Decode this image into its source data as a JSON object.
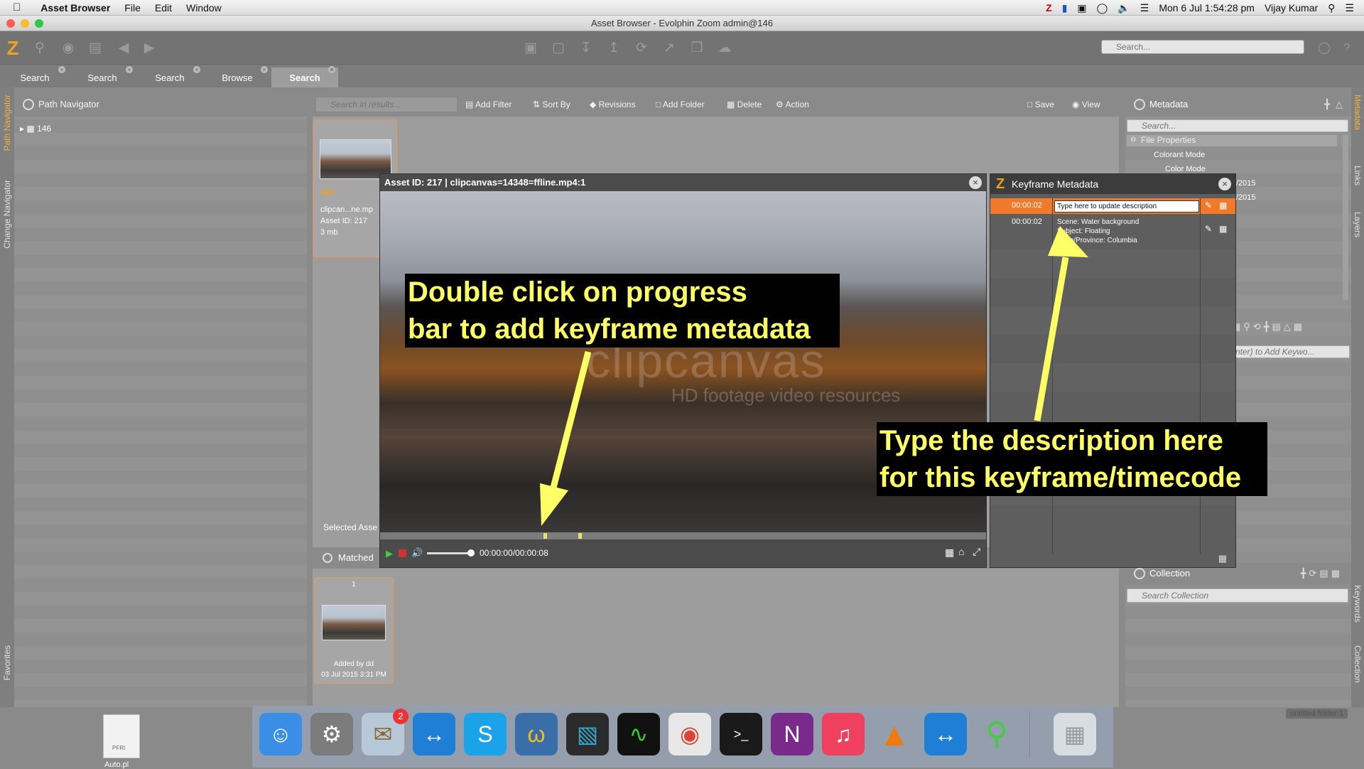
{
  "menubar": {
    "apple": "",
    "app_name": "Asset Browser",
    "menus": [
      "File",
      "Edit",
      "Window"
    ],
    "datetime": "Mon 6 Jul  1:54:28 pm",
    "user": "Vijay Kumar"
  },
  "window": {
    "title": "Asset Browser - Evolphin Zoom admin@146"
  },
  "toolbar": {
    "logo": "Z",
    "search_placeholder": "Search..."
  },
  "tabs": [
    {
      "label": "Search"
    },
    {
      "label": "Search"
    },
    {
      "label": "Search"
    },
    {
      "label": "Browse"
    },
    {
      "label": "Search"
    }
  ],
  "left_strip": {
    "path_navigator": "Path Navigator",
    "change_navigator": "Change Navigator",
    "favorites": "Favorites"
  },
  "path_navigator": {
    "title": "Path Navigator",
    "tree_item": "146"
  },
  "center": {
    "search_placeholder": "Search in results...",
    "add_filter": "Add Filter",
    "sort_by": "Sort By",
    "revisions": "Revisions",
    "add_folder": "Add Folder",
    "delete": "Delete",
    "action": "Action",
    "save": "Save",
    "view": "View",
    "asset_name": "clipcan...ne.mp",
    "asset_id": "Asset ID: 217",
    "asset_size": "3 mb",
    "selected_label": "Selected Asse",
    "matched_label": "Matched",
    "collection_index": "1",
    "collection_added_by": "Added by dd",
    "collection_date": "03 Jul 2015 3:31 PM"
  },
  "video": {
    "title": "Asset ID: 217 | clipcanvas=14348=ffline.mp4:1",
    "watermark": "clipcanvas",
    "watermark_sub": "HD footage video resources",
    "timecode": "00:00:00/00:00:08",
    "progress_fraction": 0.0
  },
  "keyframe": {
    "title": "Keyframe Metadata",
    "row1_time": "00:00:02",
    "row1_input": "Type here to update description",
    "row2_time": "00:00:02",
    "row2_lines": [
      "Scene: Water background",
      "Subject: Floating",
      "State/Province: Columbia"
    ]
  },
  "right": {
    "metadata_title": "Metadata",
    "search_placeholder": "Search...",
    "file_properties": "File Properties",
    "colorant_mode": "Colorant Mode",
    "color_mode": "Color Mode",
    "year1": "/2015",
    "year2": "/2015",
    "keyword_placeholder": "nter) to Add Keywo...",
    "collection_title": "Collection",
    "collection_search": "Search Collection"
  },
  "right_strip": {
    "metadata": "Metadata",
    "links": "Links",
    "layers": "Layers",
    "keywords": "Keywords",
    "collection": "Collection"
  },
  "annotations": {
    "a1_line1": "Double click on progress",
    "a1_line2": "bar to add keyframe metadata",
    "a2_line1": "Type the description here",
    "a2_line2": "for this keyframe/timecode"
  },
  "desktop": {
    "file_label": "PFRI",
    "file_caption": "Auto.pl",
    "folder_label": "untitled folder 1",
    "mail_badge": "2"
  },
  "colors": {
    "accent_orange": "#f07a2a",
    "annotation_yellow": "#ffff66",
    "annotation_bg": "#000000"
  }
}
